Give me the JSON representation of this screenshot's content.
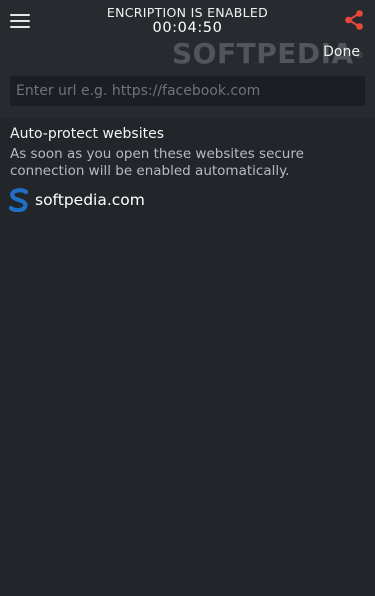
{
  "header": {
    "status_line": "ENCRIPTION IS ENABLED",
    "timer": "00:04:50",
    "done_label": "Done",
    "menu_icon": "hamburger-menu-icon",
    "share_icon": "share-icon",
    "share_color": "#e8473c"
  },
  "watermark": {
    "text": "SOFTPEDIA",
    "mark": "®"
  },
  "url_input": {
    "value": "",
    "placeholder": "Enter url e.g. https://facebook.com"
  },
  "auto_protect": {
    "title": "Auto-protect websites",
    "description": "As soon as you open these websites secure connection will be enabled automatically.",
    "sites": [
      {
        "label": "softpedia.com",
        "icon": "softpedia-logo-icon",
        "icon_color": "#1f6fc5"
      }
    ]
  },
  "colors": {
    "background": "#22262b",
    "header_background": "#272b30",
    "input_background": "#1b1e22"
  }
}
